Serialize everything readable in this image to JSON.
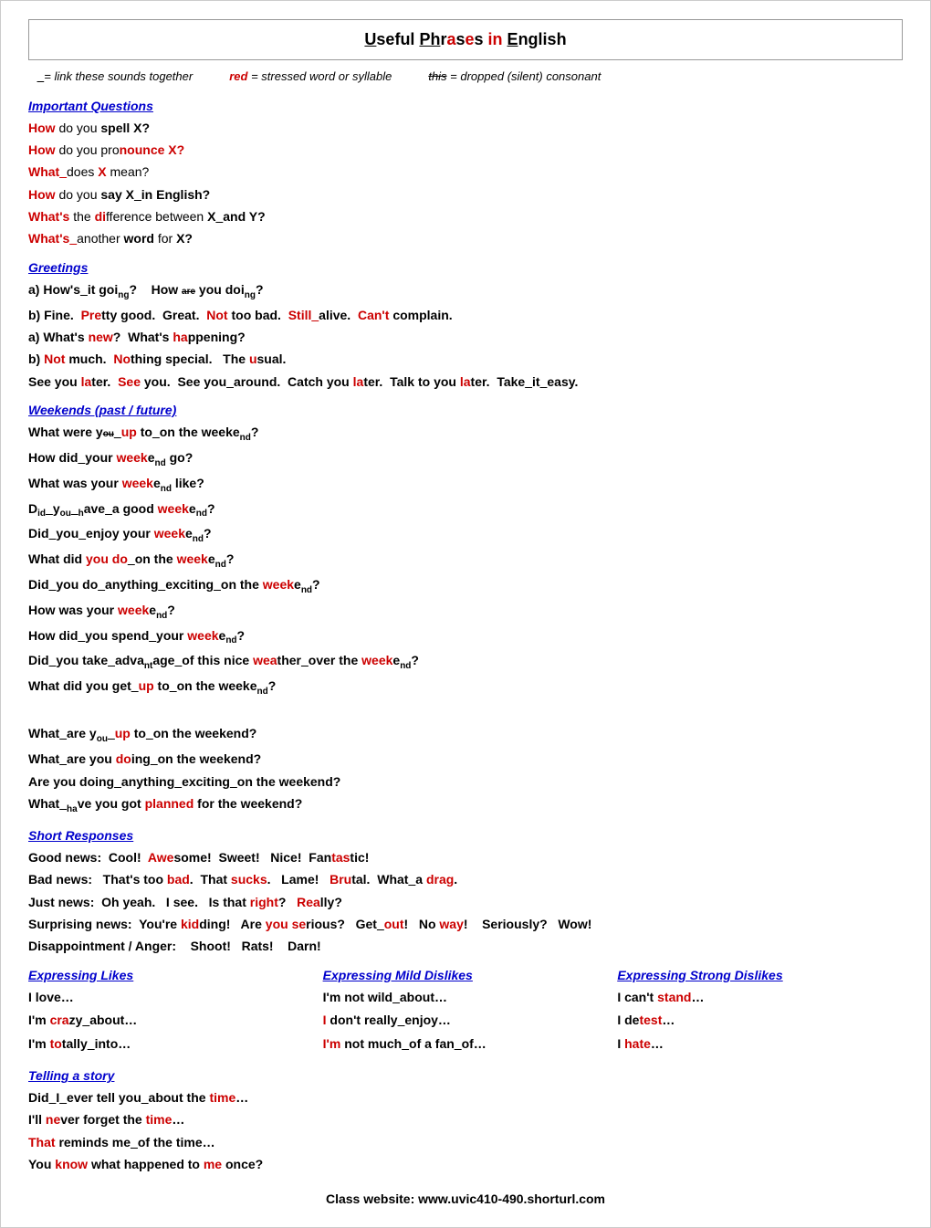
{
  "title": "Useful Phrases in English",
  "legend": {
    "join": "_= link these sounds together",
    "red": "red = stressed word or syllable",
    "silent": "this = dropped (silent) consonant"
  },
  "footer": "Class website: www.uvic410-490.shorturl.com"
}
